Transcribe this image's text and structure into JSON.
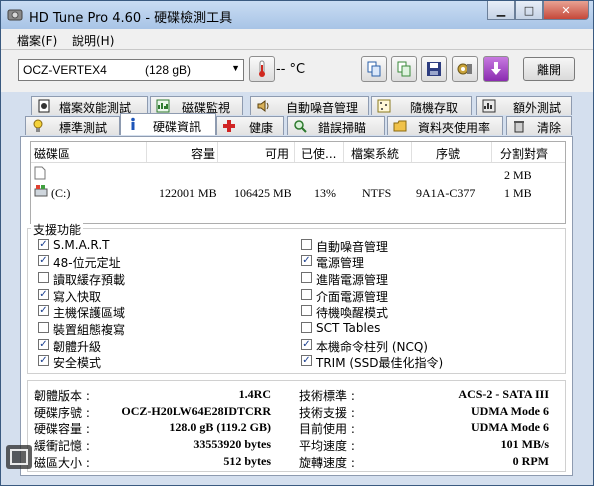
{
  "window": {
    "title": "HD Tune Pro 4.60 - 硬碟檢測工具"
  },
  "menu": [
    {
      "label": "檔案(F)"
    },
    {
      "label": "說明(H)"
    }
  ],
  "toolbar": {
    "drive_name": "OCZ-VERTEX4",
    "drive_size": "(128 gB)",
    "temperature": "-- °C",
    "exit_label": "離開"
  },
  "tabs_row1": [
    {
      "label": "檔案效能測試",
      "icon": "file-benchmark-icon"
    },
    {
      "label": "磁碟監視",
      "icon": "disk-monitor-icon"
    },
    {
      "label": "自動噪音管理",
      "icon": "speaker-icon"
    },
    {
      "label": "隨機存取",
      "icon": "random-access-icon"
    },
    {
      "label": "額外測試",
      "icon": "extra-tests-icon"
    }
  ],
  "tabs_row2": [
    {
      "label": "標準測試",
      "icon": "lightbulb-icon"
    },
    {
      "label": "硬碟資訊",
      "icon": "info-icon"
    },
    {
      "label": "健康",
      "icon": "health-cross-icon"
    },
    {
      "label": "錯誤掃瞄",
      "icon": "magnifier-icon"
    },
    {
      "label": "資料夾使用率",
      "icon": "folder-icon"
    },
    {
      "label": "清除",
      "icon": "trash-icon"
    }
  ],
  "partitions": {
    "headers": [
      "磁碟區",
      "容量",
      "可用",
      "已使...",
      "檔案系統",
      "序號",
      "分割對齊"
    ],
    "rows": [
      {
        "volume": "",
        "capacity": "",
        "free": "",
        "used": "",
        "fs": "",
        "serial": "",
        "align": "2 MB"
      },
      {
        "volume": "(C:)",
        "capacity": "122001 MB",
        "free": "106425 MB",
        "used": "13%",
        "fs": "NTFS",
        "serial": "9A1A-C377",
        "align": "1 MB"
      }
    ]
  },
  "features": {
    "title": "支援功能",
    "left": [
      {
        "label": "S.M.A.R.T",
        "checked": true
      },
      {
        "label": "48-位元定址",
        "checked": true
      },
      {
        "label": "讀取緩存預載",
        "checked": false
      },
      {
        "label": "寫入快取",
        "checked": true
      },
      {
        "label": "主機保護區域",
        "checked": true
      },
      {
        "label": "裝置組態複寫",
        "checked": false
      },
      {
        "label": "韌體升級",
        "checked": true
      },
      {
        "label": "安全模式",
        "checked": true
      }
    ],
    "right": [
      {
        "label": "自動噪音管理",
        "checked": false
      },
      {
        "label": "電源管理",
        "checked": true
      },
      {
        "label": "進階電源管理",
        "checked": false
      },
      {
        "label": "介面電源管理",
        "checked": false
      },
      {
        "label": "待機喚醒模式",
        "checked": false
      },
      {
        "label": "SCT Tables",
        "checked": false
      },
      {
        "label": "本機命令柱列 (NCQ)",
        "checked": true
      },
      {
        "label": "TRIM (SSD最佳化指令)",
        "checked": true
      }
    ]
  },
  "info": {
    "left": [
      {
        "label": "韌體版本 :",
        "value": "1.4RC"
      },
      {
        "label": "硬碟序號 :",
        "value": "OCZ-H20LW64E28IDTCRR"
      },
      {
        "label": "硬碟容量 :",
        "value": "128.0 gB (119.2 GB)"
      },
      {
        "label": "緩衝記憶 :",
        "value": "33553920 bytes"
      },
      {
        "label": "磁區大小 :",
        "value": "512 bytes"
      }
    ],
    "right": [
      {
        "label": "技術標準 :",
        "value": "ACS-2 - SATA III"
      },
      {
        "label": "技術支援 :",
        "value": "UDMA Mode 6"
      },
      {
        "label": "目前使用 :",
        "value": "UDMA Mode 6"
      },
      {
        "label": "平均速度 :",
        "value": "101 MB/s"
      },
      {
        "label": "旋轉速度 :",
        "value": "0 RPM"
      }
    ]
  },
  "checkmark": "✓"
}
